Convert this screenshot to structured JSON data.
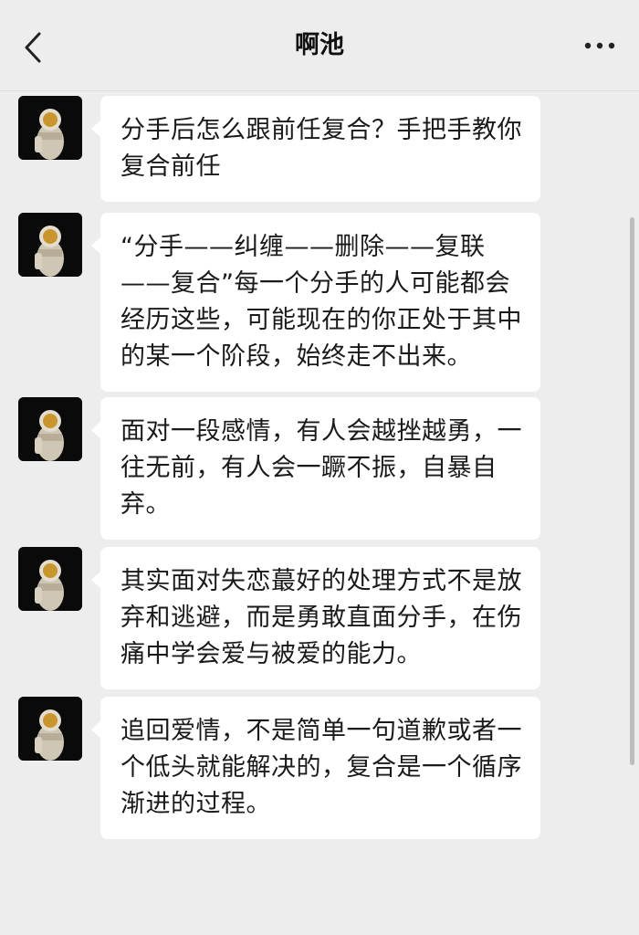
{
  "header": {
    "title": "啊池",
    "back_icon": "chevron-left-icon",
    "more_icon": "more-dots-icon"
  },
  "messages": [
    {
      "text": "分手后怎么跟前任复合？手把手教你复合前任"
    },
    {
      "text": "“分手——纠缠——删除——复联——复合”每一个分手的人可能都会经历这些，可能现在的你正处于其中的某一个阶段，始终走不出来。"
    },
    {
      "text": "面对一段感情，有人会越挫越勇，一往无前，有人会一蹶不振，自暴自弃。"
    },
    {
      "text": "其实面对失恋蕞好的处理方式不是放弃和逃避，而是勇敢直面分手，在伤痛中学会爱与被爱的能力。"
    },
    {
      "text": "追回爱情，不是简单一句道歉或者一个低头就能解决的，复合是一个循序渐进的过程。"
    }
  ],
  "colors": {
    "background": "#ededed",
    "bubble": "#ffffff",
    "text": "#1a1a1a"
  }
}
